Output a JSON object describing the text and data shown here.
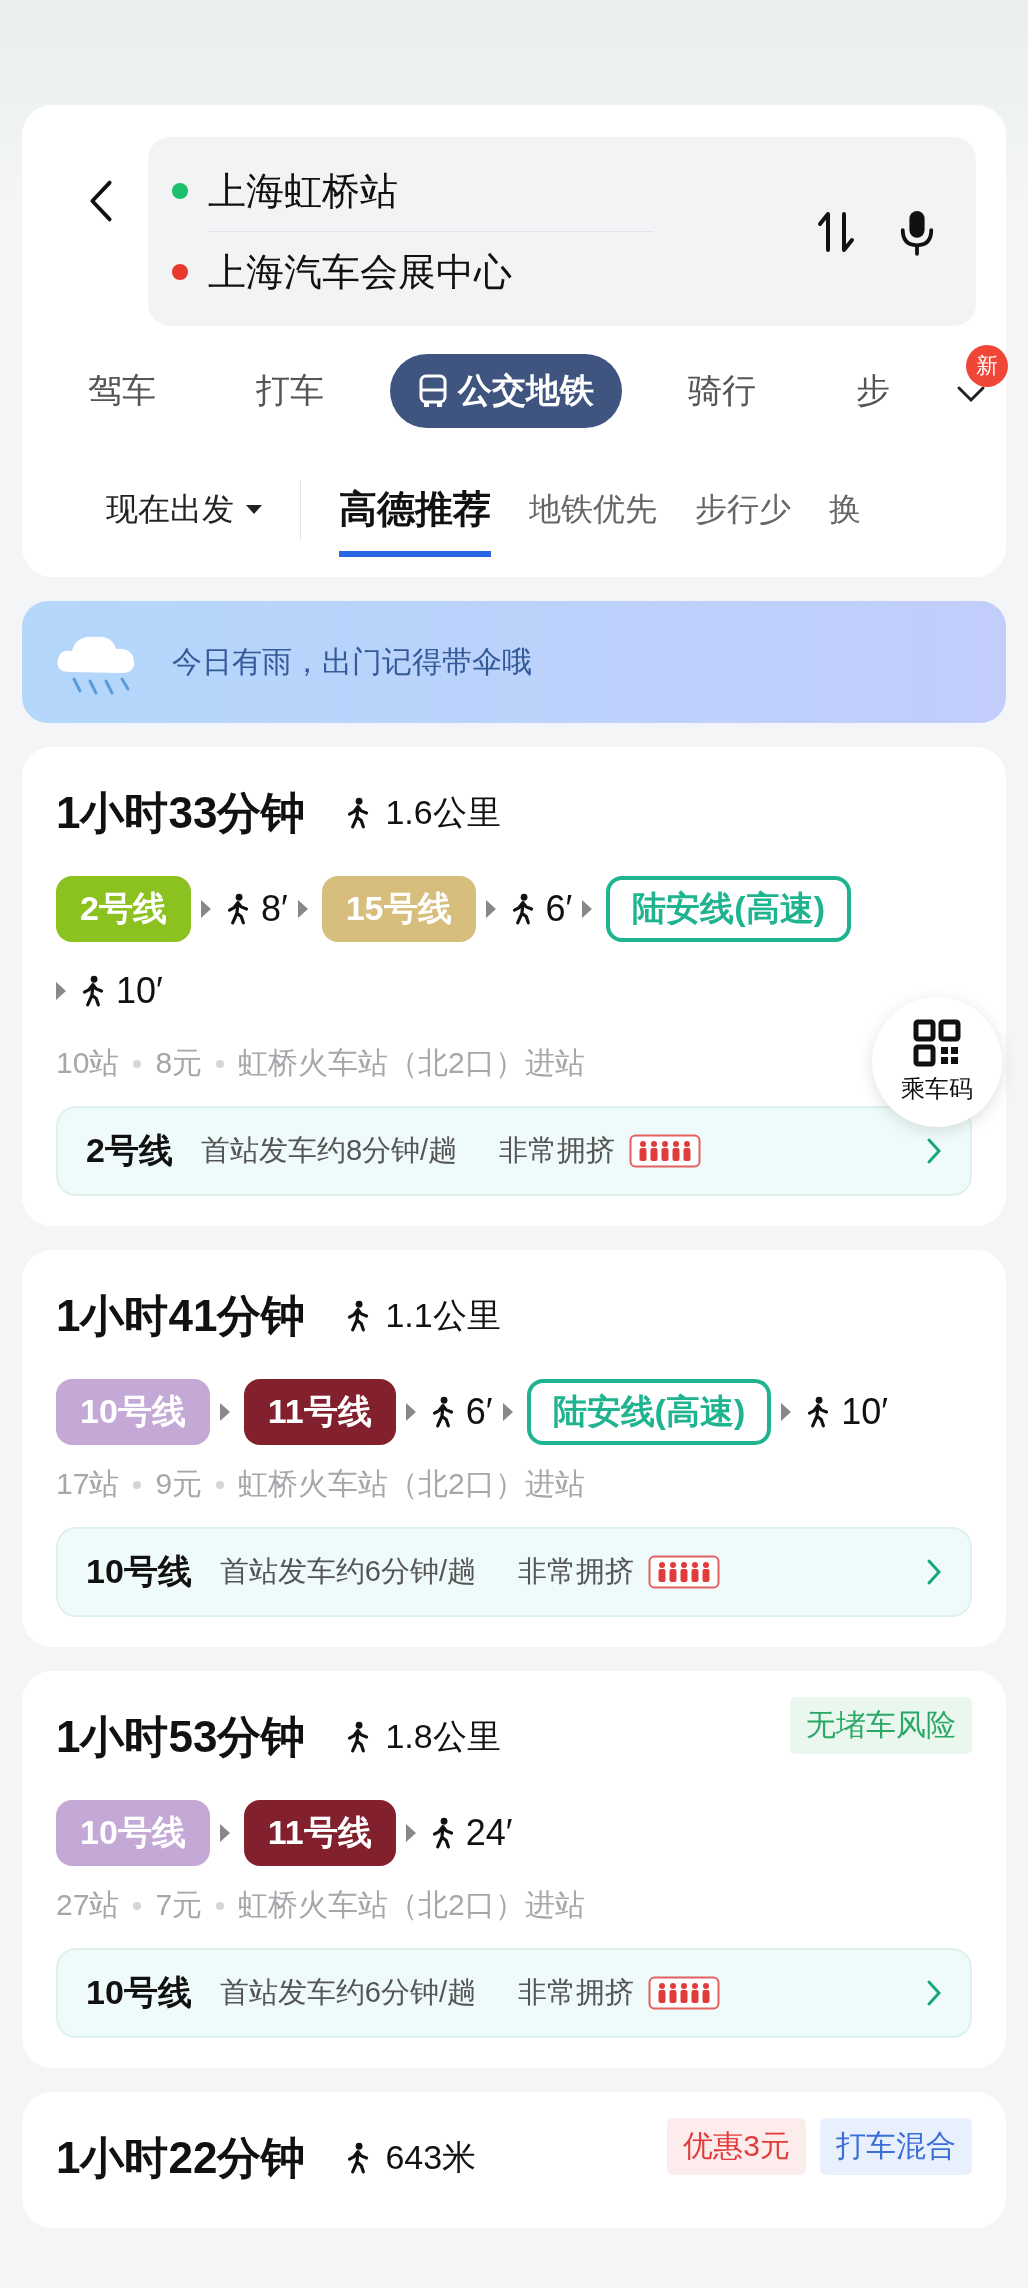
{
  "search": {
    "origin": "上海虹桥站",
    "destination": "上海汽车会展中心"
  },
  "modes": [
    {
      "label": "驾车",
      "selected": false
    },
    {
      "label": "打车",
      "selected": false
    },
    {
      "label": "公交地铁",
      "selected": true
    },
    {
      "label": "骑行",
      "selected": false
    },
    {
      "label": "步",
      "selected": false
    }
  ],
  "more_badge": "新",
  "depart": "现在出发",
  "sorts": [
    {
      "label": "高德推荐",
      "selected": true
    },
    {
      "label": "地铁优先",
      "selected": false
    },
    {
      "label": "步行少",
      "selected": false
    },
    {
      "label": "换",
      "selected": false
    }
  ],
  "weather": "今日有雨，出门记得带伞哦",
  "qr_button": "乘车码",
  "routes": [
    {
      "duration": "1小时33分钟",
      "walk": "1.6公里",
      "steps": [
        {
          "kind": "line",
          "text": "2号线",
          "color": "#8cc220"
        },
        {
          "kind": "walk",
          "text": "8′"
        },
        {
          "kind": "line",
          "text": "15号线",
          "color": "#d8be7c"
        },
        {
          "kind": "walk",
          "text": "6′"
        },
        {
          "kind": "express",
          "text": "陆安线(高速)",
          "color": "#1fb48f"
        },
        {
          "kind": "walk",
          "text": "10′"
        }
      ],
      "info": [
        "10站",
        "8元",
        "虹桥火车站（北2口）进站"
      ],
      "detail": {
        "line": "2号线",
        "frequency": "首站发车约8分钟/趟",
        "crowding": "非常拥挤"
      }
    },
    {
      "duration": "1小时41分钟",
      "walk": "1.1公里",
      "steps": [
        {
          "kind": "line",
          "text": "10号线",
          "color": "#c4a9d6"
        },
        {
          "kind": "line",
          "text": "11号线",
          "color": "#82202d"
        },
        {
          "kind": "walk",
          "text": "6′"
        },
        {
          "kind": "express",
          "text": "陆安线(高速)",
          "color": "#1fb48f"
        },
        {
          "kind": "walk",
          "text": "10′"
        }
      ],
      "info": [
        "17站",
        "9元",
        "虹桥火车站（北2口）进站"
      ],
      "detail": {
        "line": "10号线",
        "frequency": "首站发车约6分钟/趟",
        "crowding": "非常拥挤"
      }
    },
    {
      "duration": "1小时53分钟",
      "walk": "1.8公里",
      "tags": [
        {
          "text": "无堵车风险",
          "kind": "safe"
        }
      ],
      "steps": [
        {
          "kind": "line",
          "text": "10号线",
          "color": "#c4a9d6"
        },
        {
          "kind": "line",
          "text": "11号线",
          "color": "#82202d"
        },
        {
          "kind": "walk",
          "text": "24′"
        }
      ],
      "info": [
        "27站",
        "7元",
        "虹桥火车站（北2口）进站"
      ],
      "detail": {
        "line": "10号线",
        "frequency": "首站发车约6分钟/趟",
        "crowding": "非常拥挤"
      }
    },
    {
      "duration": "1小时22分钟",
      "walk": "643米",
      "tags": [
        {
          "text": "优惠3元",
          "kind": "discount"
        },
        {
          "text": "打车混合",
          "kind": "mix"
        }
      ]
    }
  ]
}
